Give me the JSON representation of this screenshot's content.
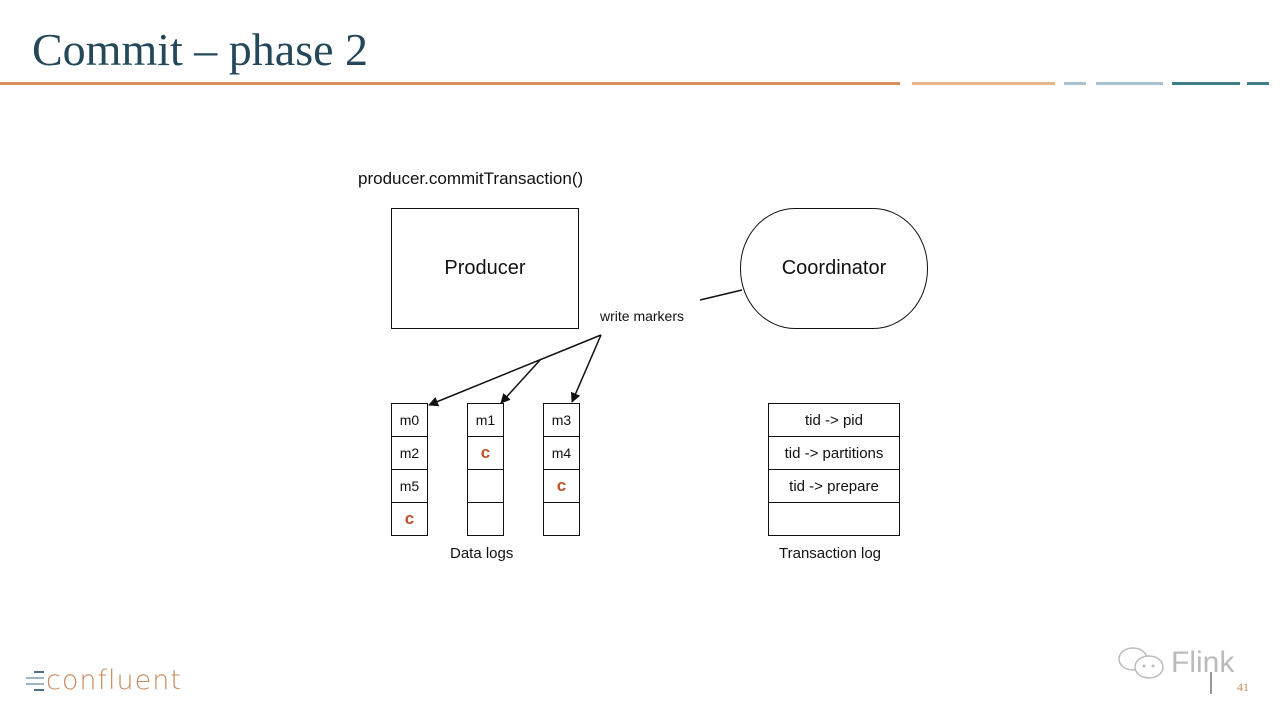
{
  "slide": {
    "title": "Commit – phase 2",
    "page_number": "41",
    "accent_colors": {
      "title": "#24485a",
      "rule_orange": "#d9925e",
      "rule_light_orange": "#e8b48c",
      "rule_light_blue": "#a9c1d0",
      "rule_teal": "#3f7f8c",
      "marker_red": "#c0522a"
    }
  },
  "diagram": {
    "call_label": "producer.commitTransaction()",
    "producer_label": "Producer",
    "coordinator_label": "Coordinator",
    "write_markers_label": "write markers",
    "data_logs": {
      "caption": "Data logs",
      "partitions": [
        {
          "cells": [
            "m0",
            "m2",
            "m5",
            "c"
          ]
        },
        {
          "cells": [
            "m1",
            "c",
            "",
            ""
          ]
        },
        {
          "cells": [
            "m3",
            "m4",
            "c",
            ""
          ]
        }
      ]
    },
    "transaction_log": {
      "caption": "Transaction log",
      "cells": [
        "tid -> pid",
        "tid -> partitions",
        "tid -> prepare",
        ""
      ]
    }
  },
  "footer": {
    "logo_text": "confluent",
    "watermark_text": "Flink"
  }
}
